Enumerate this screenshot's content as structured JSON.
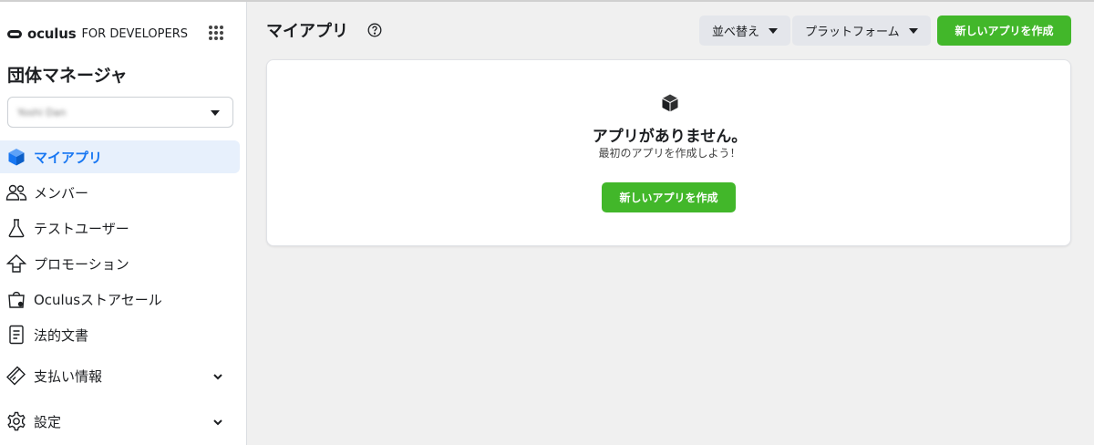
{
  "brand": {
    "name": "oculus",
    "suffix": "FOR DEVELOPERS"
  },
  "sidebar": {
    "org_title": "団体マネージャ",
    "org_select_value": "Yoshi Dan",
    "items": [
      {
        "label": "マイアプリ",
        "icon": "cube-icon",
        "active": true
      },
      {
        "label": "メンバー",
        "icon": "people-icon"
      },
      {
        "label": "テストユーザー",
        "icon": "flask-icon"
      },
      {
        "label": "プロモーション",
        "icon": "arrow-up-icon"
      },
      {
        "label": "Oculusストアセール",
        "icon": "shopping-bag-icon"
      },
      {
        "label": "法的文書",
        "icon": "document-icon"
      },
      {
        "label": "支払い情報",
        "icon": "credit-card-icon",
        "expandable": true
      },
      {
        "label": "設定",
        "icon": "gear-icon",
        "expandable": true
      }
    ]
  },
  "main": {
    "title": "マイアプリ",
    "sort_label": "並べ替え",
    "platform_label": "プラットフォーム",
    "create_label": "新しいアプリを作成",
    "empty": {
      "title": "アプリがありません。",
      "subtitle": "最初のアプリを作成しよう！",
      "button": "新しいアプリを作成"
    }
  },
  "colors": {
    "accent": "#1877f2",
    "primary_button": "#42b72a",
    "active_bg": "#e7f0fc",
    "page_bg": "#f0f0f0"
  }
}
